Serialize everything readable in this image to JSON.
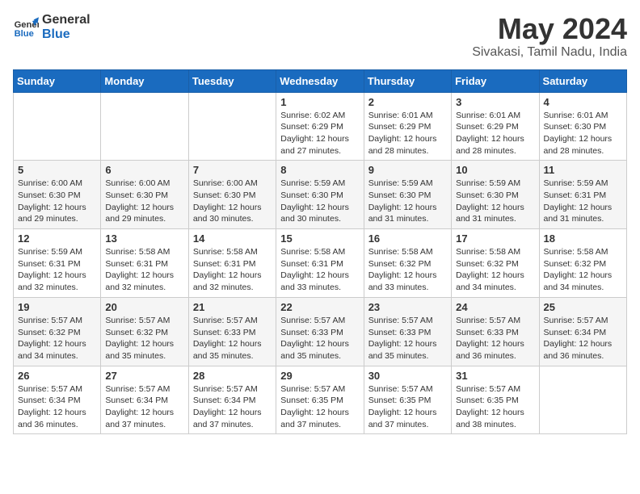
{
  "header": {
    "logo": {
      "line1": "General",
      "line2": "Blue"
    },
    "title": "May 2024",
    "subtitle": "Sivakasi, Tamil Nadu, India"
  },
  "days_of_week": [
    "Sunday",
    "Monday",
    "Tuesday",
    "Wednesday",
    "Thursday",
    "Friday",
    "Saturday"
  ],
  "weeks": [
    [
      {
        "day": "",
        "info": ""
      },
      {
        "day": "",
        "info": ""
      },
      {
        "day": "",
        "info": ""
      },
      {
        "day": "1",
        "info": "Sunrise: 6:02 AM\nSunset: 6:29 PM\nDaylight: 12 hours\nand 27 minutes."
      },
      {
        "day": "2",
        "info": "Sunrise: 6:01 AM\nSunset: 6:29 PM\nDaylight: 12 hours\nand 28 minutes."
      },
      {
        "day": "3",
        "info": "Sunrise: 6:01 AM\nSunset: 6:29 PM\nDaylight: 12 hours\nand 28 minutes."
      },
      {
        "day": "4",
        "info": "Sunrise: 6:01 AM\nSunset: 6:30 PM\nDaylight: 12 hours\nand 28 minutes."
      }
    ],
    [
      {
        "day": "5",
        "info": "Sunrise: 6:00 AM\nSunset: 6:30 PM\nDaylight: 12 hours\nand 29 minutes."
      },
      {
        "day": "6",
        "info": "Sunrise: 6:00 AM\nSunset: 6:30 PM\nDaylight: 12 hours\nand 29 minutes."
      },
      {
        "day": "7",
        "info": "Sunrise: 6:00 AM\nSunset: 6:30 PM\nDaylight: 12 hours\nand 30 minutes."
      },
      {
        "day": "8",
        "info": "Sunrise: 5:59 AM\nSunset: 6:30 PM\nDaylight: 12 hours\nand 30 minutes."
      },
      {
        "day": "9",
        "info": "Sunrise: 5:59 AM\nSunset: 6:30 PM\nDaylight: 12 hours\nand 31 minutes."
      },
      {
        "day": "10",
        "info": "Sunrise: 5:59 AM\nSunset: 6:30 PM\nDaylight: 12 hours\nand 31 minutes."
      },
      {
        "day": "11",
        "info": "Sunrise: 5:59 AM\nSunset: 6:31 PM\nDaylight: 12 hours\nand 31 minutes."
      }
    ],
    [
      {
        "day": "12",
        "info": "Sunrise: 5:59 AM\nSunset: 6:31 PM\nDaylight: 12 hours\nand 32 minutes."
      },
      {
        "day": "13",
        "info": "Sunrise: 5:58 AM\nSunset: 6:31 PM\nDaylight: 12 hours\nand 32 minutes."
      },
      {
        "day": "14",
        "info": "Sunrise: 5:58 AM\nSunset: 6:31 PM\nDaylight: 12 hours\nand 32 minutes."
      },
      {
        "day": "15",
        "info": "Sunrise: 5:58 AM\nSunset: 6:31 PM\nDaylight: 12 hours\nand 33 minutes."
      },
      {
        "day": "16",
        "info": "Sunrise: 5:58 AM\nSunset: 6:32 PM\nDaylight: 12 hours\nand 33 minutes."
      },
      {
        "day": "17",
        "info": "Sunrise: 5:58 AM\nSunset: 6:32 PM\nDaylight: 12 hours\nand 34 minutes."
      },
      {
        "day": "18",
        "info": "Sunrise: 5:58 AM\nSunset: 6:32 PM\nDaylight: 12 hours\nand 34 minutes."
      }
    ],
    [
      {
        "day": "19",
        "info": "Sunrise: 5:57 AM\nSunset: 6:32 PM\nDaylight: 12 hours\nand 34 minutes."
      },
      {
        "day": "20",
        "info": "Sunrise: 5:57 AM\nSunset: 6:32 PM\nDaylight: 12 hours\nand 35 minutes."
      },
      {
        "day": "21",
        "info": "Sunrise: 5:57 AM\nSunset: 6:33 PM\nDaylight: 12 hours\nand 35 minutes."
      },
      {
        "day": "22",
        "info": "Sunrise: 5:57 AM\nSunset: 6:33 PM\nDaylight: 12 hours\nand 35 minutes."
      },
      {
        "day": "23",
        "info": "Sunrise: 5:57 AM\nSunset: 6:33 PM\nDaylight: 12 hours\nand 35 minutes."
      },
      {
        "day": "24",
        "info": "Sunrise: 5:57 AM\nSunset: 6:33 PM\nDaylight: 12 hours\nand 36 minutes."
      },
      {
        "day": "25",
        "info": "Sunrise: 5:57 AM\nSunset: 6:34 PM\nDaylight: 12 hours\nand 36 minutes."
      }
    ],
    [
      {
        "day": "26",
        "info": "Sunrise: 5:57 AM\nSunset: 6:34 PM\nDaylight: 12 hours\nand 36 minutes."
      },
      {
        "day": "27",
        "info": "Sunrise: 5:57 AM\nSunset: 6:34 PM\nDaylight: 12 hours\nand 37 minutes."
      },
      {
        "day": "28",
        "info": "Sunrise: 5:57 AM\nSunset: 6:34 PM\nDaylight: 12 hours\nand 37 minutes."
      },
      {
        "day": "29",
        "info": "Sunrise: 5:57 AM\nSunset: 6:35 PM\nDaylight: 12 hours\nand 37 minutes."
      },
      {
        "day": "30",
        "info": "Sunrise: 5:57 AM\nSunset: 6:35 PM\nDaylight: 12 hours\nand 37 minutes."
      },
      {
        "day": "31",
        "info": "Sunrise: 5:57 AM\nSunset: 6:35 PM\nDaylight: 12 hours\nand 38 minutes."
      },
      {
        "day": "",
        "info": ""
      }
    ]
  ]
}
